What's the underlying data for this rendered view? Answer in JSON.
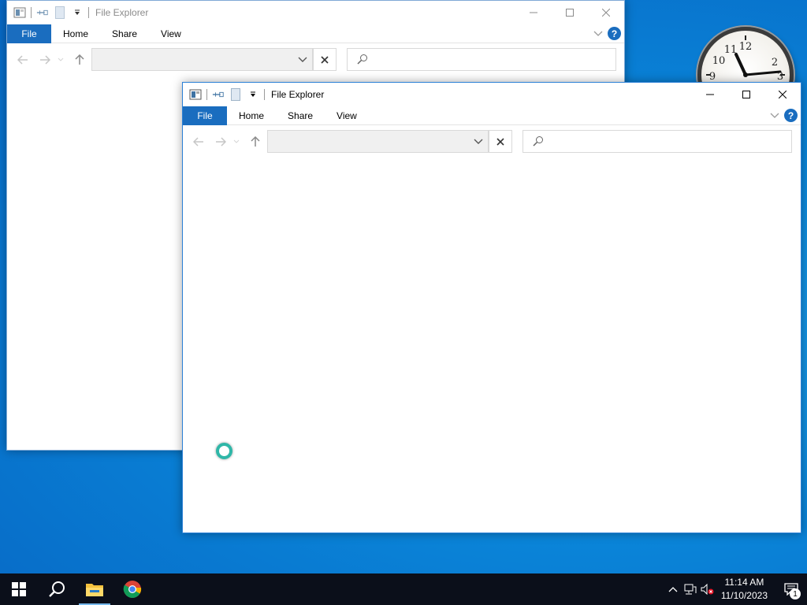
{
  "windows": [
    {
      "title": "File Explorer",
      "tabs": [
        "File",
        "Home",
        "Share",
        "View"
      ]
    },
    {
      "title": "File Explorer",
      "tabs": [
        "File",
        "Home",
        "Share",
        "View"
      ]
    }
  ],
  "clock_gadget": {
    "numerals": [
      "12",
      "2",
      "3",
      "9",
      "10",
      "11"
    ],
    "time": "11:14"
  },
  "taskbar": {
    "items": [
      "start-icon",
      "search-icon",
      "file-explorer-icon",
      "chrome-icon"
    ],
    "time": "11:14 AM",
    "date": "11/10/2023",
    "notification_count": "1"
  },
  "colors": {
    "accent": "#1a6dbf",
    "desktop": "#0a84d8",
    "taskbar": "#0b0f1a"
  }
}
